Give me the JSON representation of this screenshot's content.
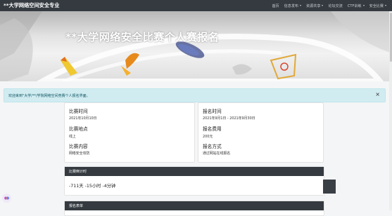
{
  "navbar": {
    "brand": "**大学网络空间安全专业",
    "links": [
      {
        "label": "首页",
        "dropdown": false
      },
      {
        "label": "信息发布",
        "dropdown": true
      },
      {
        "label": "资源共享",
        "dropdown": true
      },
      {
        "label": "论坛交流",
        "dropdown": false
      },
      {
        "label": "CTF训练",
        "dropdown": true
      },
      {
        "label": "安全比赛",
        "dropdown": true
      }
    ]
  },
  "hero": {
    "title": "**大学网络安全比赛个人赛报名"
  },
  "alert": {
    "message": "欢迎来到\"大学/**/学院网络空间竞赛个人报名界面。",
    "close": "×"
  },
  "info_left": {
    "time_label": "比赛时间",
    "time_value": "2021年10月10日",
    "place_label": "比赛地点",
    "place_value": "线上",
    "content_label": "比赛内容",
    "content_value": "网络安全攻防"
  },
  "info_right": {
    "reg_time_label": "报名时间",
    "reg_time_value": "2021年9月1日 - 2021年9月30日",
    "fee_label": "报名费用",
    "fee_value": "200元",
    "method_label": "报名方式",
    "method_value": "通过网站在线报名"
  },
  "countdown": {
    "header": "比赛倒计时",
    "value": "-711天 -15小时 -4分钟"
  },
  "form": {
    "header": "报名表单"
  },
  "colors": {
    "navbar_bg": "#343a40",
    "alert_bg": "#d1ecf1",
    "alert_text": "#0c5460",
    "card_header_bg": "#343a40"
  }
}
